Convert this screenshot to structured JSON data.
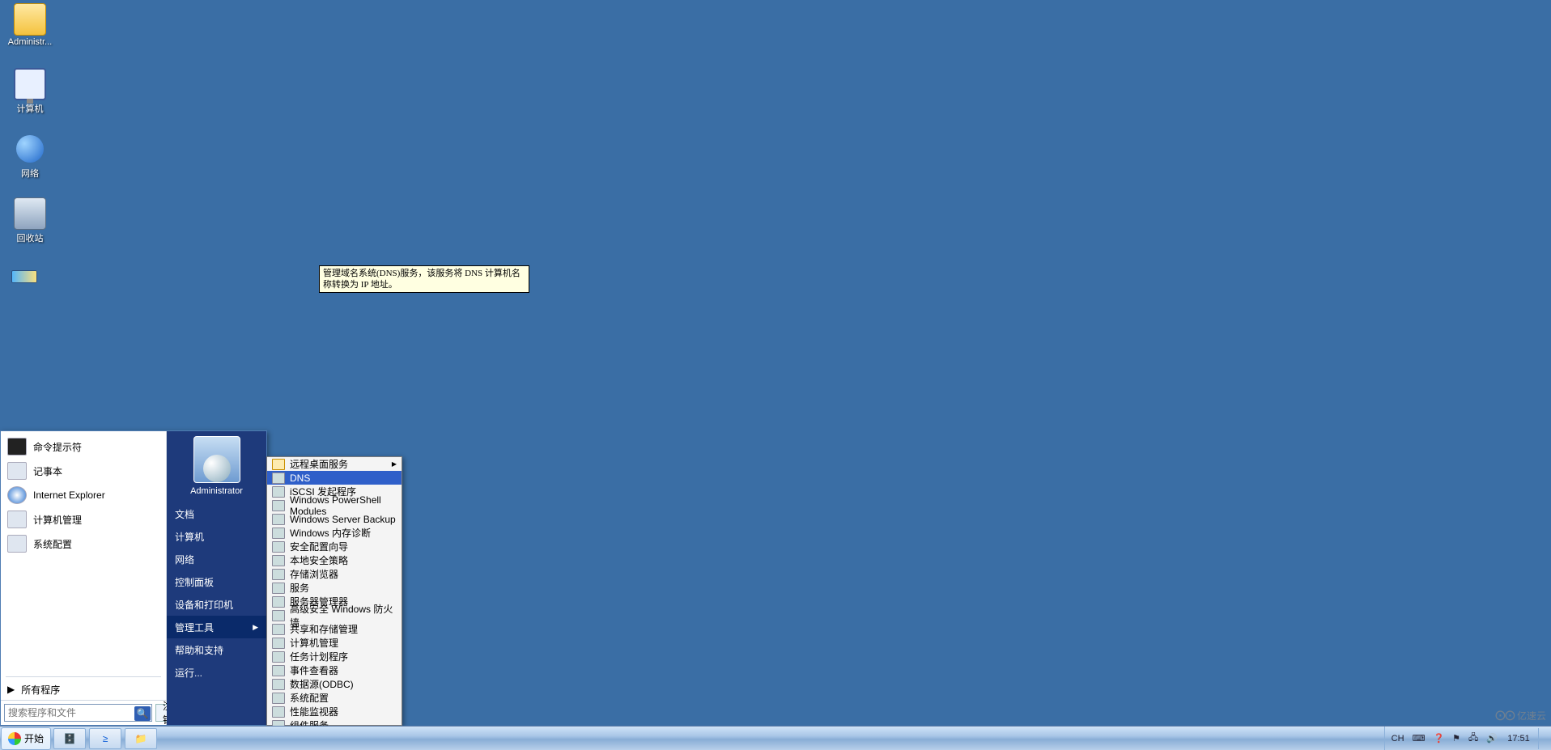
{
  "desktop_icons": [
    {
      "label": "Administr..."
    },
    {
      "label": "计算机"
    },
    {
      "label": "网络"
    },
    {
      "label": "回收站"
    }
  ],
  "start_menu": {
    "left_programs": [
      {
        "label": "命令提示符"
      },
      {
        "label": "记事本"
      },
      {
        "label": "Internet Explorer"
      },
      {
        "label": "计算机管理"
      },
      {
        "label": "系统配置"
      }
    ],
    "all_programs": "所有程序",
    "search_placeholder": "搜索程序和文件",
    "logoff": "注销",
    "user": "Administrator",
    "right_items": [
      {
        "label": "文档"
      },
      {
        "label": "计算机"
      },
      {
        "label": "网络"
      },
      {
        "label": "控制面板"
      },
      {
        "label": "设备和打印机"
      },
      {
        "label": "管理工具",
        "submenu": true,
        "selected": true
      },
      {
        "label": "帮助和支持"
      },
      {
        "label": "运行..."
      }
    ]
  },
  "admin_tools": [
    {
      "label": "远程桌面服务",
      "folder": true,
      "sub": true
    },
    {
      "label": "DNS",
      "selected": true
    },
    {
      "label": "iSCSI 发起程序"
    },
    {
      "label": "Windows PowerShell Modules"
    },
    {
      "label": "Windows Server Backup"
    },
    {
      "label": "Windows 内存诊断"
    },
    {
      "label": "安全配置向导"
    },
    {
      "label": "本地安全策略"
    },
    {
      "label": "存储浏览器"
    },
    {
      "label": "服务"
    },
    {
      "label": "服务器管理器"
    },
    {
      "label": "高级安全 Windows 防火墙"
    },
    {
      "label": "共享和存储管理"
    },
    {
      "label": "计算机管理"
    },
    {
      "label": "任务计划程序"
    },
    {
      "label": "事件查看器"
    },
    {
      "label": "数据源(ODBC)"
    },
    {
      "label": "系统配置"
    },
    {
      "label": "性能监视器"
    },
    {
      "label": "组件服务"
    }
  ],
  "tooltip": "管理域名系统(DNS)服务，该服务将 DNS 计算机名称转换为 IP 地址。",
  "taskbar": {
    "start": "开始",
    "lang": "CH",
    "clock": "17:51"
  },
  "watermark": "亿速云"
}
